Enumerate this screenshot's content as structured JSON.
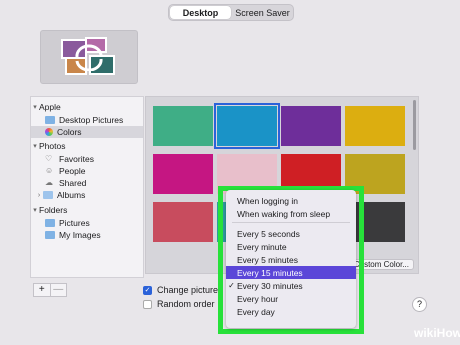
{
  "tabs": [
    {
      "label": "Desktop",
      "active": true
    },
    {
      "label": "Screen Saver",
      "active": false
    }
  ],
  "sidebar": {
    "sections": [
      {
        "label": "Apple",
        "items": [
          "Desktop Pictures",
          "Colors"
        ]
      },
      {
        "label": "Photos",
        "items": [
          "Favorites",
          "People",
          "Shared",
          "Albums"
        ]
      },
      {
        "label": "Folders",
        "items": [
          "Pictures",
          "My Images"
        ]
      }
    ],
    "selected": "Colors"
  },
  "swatches": [
    "#3fae86",
    "#1a93c7",
    "#6e2e9a",
    "#dcae10",
    "#c51682",
    "#e8bfcb",
    "#cf1f24",
    "#bda41f",
    "#c84c5e",
    "#2f9aa0",
    "#3e3e40",
    "#3a3a3c"
  ],
  "selected_swatch": 1,
  "custom_color_label": "Custom Color...",
  "list_controls": {
    "add": "+",
    "remove": "—"
  },
  "change_picture": {
    "label": "Change picture:",
    "checked": true
  },
  "random_order": {
    "label": "Random order",
    "checked": false
  },
  "help_label": "?",
  "menu": {
    "items": [
      {
        "label": "When logging in",
        "checked": false
      },
      {
        "label": "When waking from sleep",
        "checked": false
      },
      {
        "label": "Every 5 seconds",
        "checked": false
      },
      {
        "label": "Every minute",
        "checked": false
      },
      {
        "label": "Every 5 minutes",
        "checked": false
      },
      {
        "label": "Every 15 minutes",
        "checked": false,
        "highlighted": true
      },
      {
        "label": "Every 30 minutes",
        "checked": true
      },
      {
        "label": "Every hour",
        "checked": false
      },
      {
        "label": "Every day",
        "checked": false
      }
    ]
  },
  "watermark": "wikiHow",
  "colors": {
    "accent": "#2b62d9",
    "menu_highlight": "#5b46d8",
    "annotation": "#27e13a"
  }
}
